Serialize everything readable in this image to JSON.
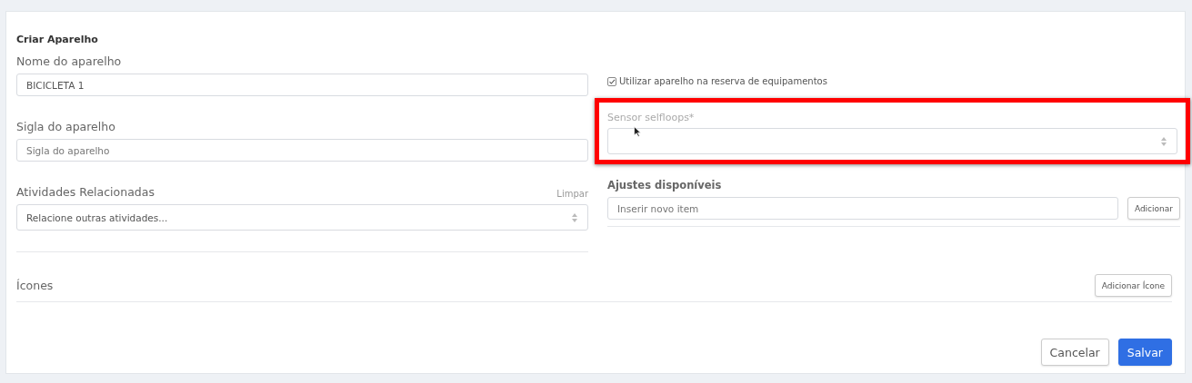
{
  "title": "Criar Aparelho",
  "left": [
    {
      "kind": "input",
      "label": "Nome do aparelho",
      "value": "BICICLETA 1"
    },
    {
      "kind": "input",
      "label": "Sigla do aparelho",
      "placeholder": "Sigla do aparelho"
    },
    {
      "kind": "select",
      "label": "Atividades Relacionadas",
      "action": "Limpar",
      "placeholder": "Relacione outras atividades..."
    }
  ],
  "reserve_checkbox": {
    "label": "Utilizar aparelho na reserva de equipamentos",
    "checked": true
  },
  "sensor": {
    "label": "Sensor selfloops*",
    "highlighted": true
  },
  "adjustments": {
    "label": "Ajustes disponíveis",
    "placeholder": "Inserir novo item",
    "button": "Adicionar"
  },
  "icons_section": {
    "label": "Ícones",
    "button": "Adicionar Ícone"
  },
  "buttons": [
    {
      "label": "Cancelar",
      "kind": "secondary"
    },
    {
      "label": "Salvar",
      "kind": "primary"
    }
  ]
}
